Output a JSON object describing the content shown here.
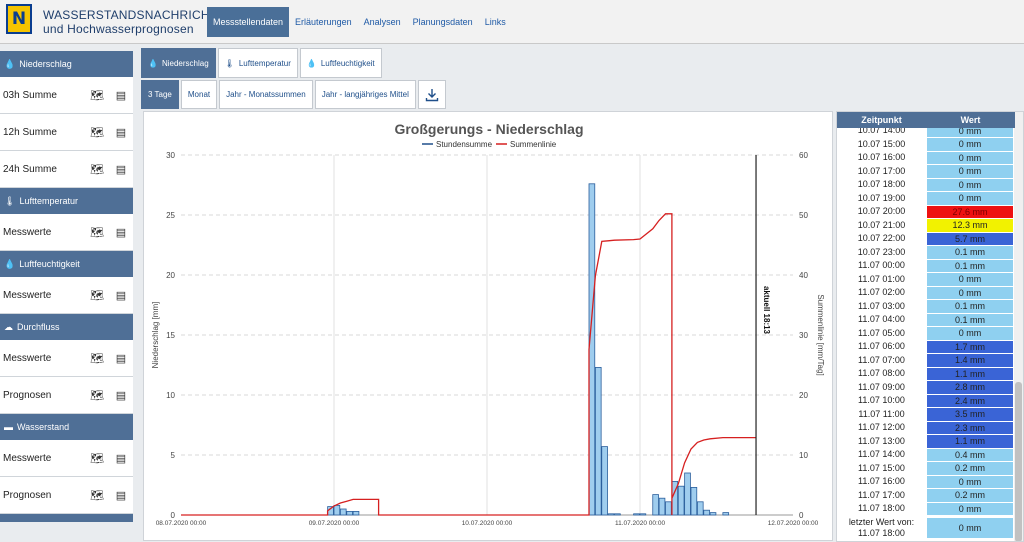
{
  "header": {
    "logo_letter": "N",
    "brand_line1": "WASSERSTANDSNACHRICHTEN",
    "brand_line2": "und Hochwasserprognosen",
    "nav": [
      "Messstellendaten",
      "Erläuterungen",
      "Analysen",
      "Planungsdaten",
      "Links"
    ]
  },
  "sidebar": {
    "sections": [
      {
        "title": "Niederschlag",
        "icon": "rain-drops-icon",
        "items": [
          "03h Summe",
          "12h Summe",
          "24h Summe"
        ]
      },
      {
        "title": "Lufttemperatur",
        "icon": "thermometer-icon",
        "items": [
          "Messwerte"
        ]
      },
      {
        "title": "Luftfeuchtigkeit",
        "icon": "drop-icon",
        "items": [
          "Messwerte"
        ]
      },
      {
        "title": "Durchfluss",
        "icon": "flow-icon",
        "items": [
          "Messwerte",
          "Prognosen"
        ]
      },
      {
        "title": "Wasserstand",
        "icon": "water-level-icon",
        "items": [
          "Messwerte",
          "Prognosen"
        ]
      }
    ]
  },
  "tabs": {
    "parameter": [
      "Niederschlag",
      "Lufttemperatur",
      "Luftfeuchtigkeit"
    ],
    "period": [
      "3 Tage",
      "Monat",
      "Jahr - Monatssummen",
      "Jahr - langjähriges Mittel"
    ]
  },
  "chart_data": {
    "type": "bar",
    "title": "Großgerungs - Niederschlag",
    "legend": [
      "Stundensumme",
      "Summenlinie"
    ],
    "ylabel": "Niederschlag [mm]",
    "y2label": "Summenlinie [mm/Tag]",
    "ylim": [
      0,
      30
    ],
    "y2lim": [
      0,
      60
    ],
    "yticks": [
      0,
      5,
      10,
      15,
      20,
      25,
      30
    ],
    "y2ticks": [
      0,
      10,
      20,
      30,
      40,
      50,
      60
    ],
    "xlim_hours": [
      0,
      96
    ],
    "xticks": [
      "08.07.2020 00:00",
      "09.07.2020 00:00",
      "10.07.2020 00:00",
      "11.07.2020 00:00",
      "12.07.2020 00:00"
    ],
    "now_hour": 90.2,
    "now_label": "aktuell 18:13",
    "bars": [
      {
        "h": 23,
        "v": 0.7
      },
      {
        "h": 24,
        "v": 0.8
      },
      {
        "h": 25,
        "v": 0.5
      },
      {
        "h": 26,
        "v": 0.3
      },
      {
        "h": 27,
        "v": 0.3
      },
      {
        "h": 64,
        "v": 27.6
      },
      {
        "h": 65,
        "v": 12.3
      },
      {
        "h": 66,
        "v": 5.7
      },
      {
        "h": 67,
        "v": 0.1
      },
      {
        "h": 68,
        "v": 0.1
      },
      {
        "h": 69,
        "v": 0.0
      },
      {
        "h": 70,
        "v": 0.0
      },
      {
        "h": 71,
        "v": 0.1
      },
      {
        "h": 72,
        "v": 0.1
      },
      {
        "h": 73,
        "v": 0.0
      },
      {
        "h": 74,
        "v": 1.7
      },
      {
        "h": 75,
        "v": 1.4
      },
      {
        "h": 76,
        "v": 1.1
      },
      {
        "h": 77,
        "v": 2.8
      },
      {
        "h": 78,
        "v": 2.4
      },
      {
        "h": 79,
        "v": 3.5
      },
      {
        "h": 80,
        "v": 2.3
      },
      {
        "h": 81,
        "v": 1.1
      },
      {
        "h": 82,
        "v": 0.4
      },
      {
        "h": 83,
        "v": 0.2
      },
      {
        "h": 84,
        "v": 0.0
      },
      {
        "h": 85,
        "v": 0.2
      },
      {
        "h": 86,
        "v": 0.0
      },
      {
        "h": 87,
        "v": 0.0
      }
    ],
    "cumulative": [
      [
        0,
        0
      ],
      [
        23,
        0
      ],
      [
        23,
        0.7
      ],
      [
        24,
        1.5
      ],
      [
        25,
        2.0
      ],
      [
        26,
        2.3
      ],
      [
        27,
        2.6
      ],
      [
        31,
        2.6
      ],
      [
        31,
        0
      ],
      [
        64,
        0
      ],
      [
        64,
        27.6
      ],
      [
        65,
        39.9
      ],
      [
        66,
        45.6
      ],
      [
        67,
        45.7
      ],
      [
        68,
        45.8
      ],
      [
        71,
        45.9
      ],
      [
        72,
        46.0
      ],
      [
        74,
        47.7
      ],
      [
        75,
        49.1
      ],
      [
        76,
        50.2
      ],
      [
        77,
        50.2
      ],
      [
        77,
        0
      ],
      [
        77,
        2.8
      ],
      [
        78,
        5.2
      ],
      [
        79,
        8.7
      ],
      [
        80,
        11.0
      ],
      [
        81,
        12.1
      ],
      [
        82,
        12.5
      ],
      [
        83,
        12.7
      ],
      [
        85,
        12.9
      ],
      [
        87,
        12.9
      ],
      [
        90.2,
        12.9
      ]
    ]
  },
  "table": {
    "headers": [
      "Zeitpunkt",
      "Wert"
    ],
    "rows": [
      {
        "t": "10.07 14:00",
        "v": "0 mm",
        "c": "#8fd0f0"
      },
      {
        "t": "10.07 15:00",
        "v": "0 mm",
        "c": "#8fd0f0"
      },
      {
        "t": "10.07 16:00",
        "v": "0 mm",
        "c": "#8fd0f0"
      },
      {
        "t": "10.07 17:00",
        "v": "0 mm",
        "c": "#8fd0f0"
      },
      {
        "t": "10.07 18:00",
        "v": "0 mm",
        "c": "#8fd0f0"
      },
      {
        "t": "10.07 19:00",
        "v": "0 mm",
        "c": "#8fd0f0"
      },
      {
        "t": "10.07 20:00",
        "v": "27.6 mm",
        "c": "#ee1111"
      },
      {
        "t": "10.07 21:00",
        "v": "12.3 mm",
        "c": "#f2f200"
      },
      {
        "t": "10.07 22:00",
        "v": "5.7 mm",
        "c": "#3a64d6"
      },
      {
        "t": "10.07 23:00",
        "v": "0.1 mm",
        "c": "#8fd0f0"
      },
      {
        "t": "11.07 00:00",
        "v": "0.1 mm",
        "c": "#8fd0f0"
      },
      {
        "t": "11.07 01:00",
        "v": "0 mm",
        "c": "#8fd0f0"
      },
      {
        "t": "11.07 02:00",
        "v": "0 mm",
        "c": "#8fd0f0"
      },
      {
        "t": "11.07 03:00",
        "v": "0.1 mm",
        "c": "#8fd0f0"
      },
      {
        "t": "11.07 04:00",
        "v": "0.1 mm",
        "c": "#8fd0f0"
      },
      {
        "t": "11.07 05:00",
        "v": "0 mm",
        "c": "#8fd0f0"
      },
      {
        "t": "11.07 06:00",
        "v": "1.7 mm",
        "c": "#3a64d6"
      },
      {
        "t": "11.07 07:00",
        "v": "1.4 mm",
        "c": "#3a64d6"
      },
      {
        "t": "11.07 08:00",
        "v": "1.1 mm",
        "c": "#3a64d6"
      },
      {
        "t": "11.07 09:00",
        "v": "2.8 mm",
        "c": "#3a64d6"
      },
      {
        "t": "11.07 10:00",
        "v": "2.4 mm",
        "c": "#3a64d6"
      },
      {
        "t": "11.07 11:00",
        "v": "3.5 mm",
        "c": "#3a64d6"
      },
      {
        "t": "11.07 12:00",
        "v": "2.3 mm",
        "c": "#3a64d6"
      },
      {
        "t": "11.07 13:00",
        "v": "1.1 mm",
        "c": "#3a64d6"
      },
      {
        "t": "11.07 14:00",
        "v": "0.4 mm",
        "c": "#8fd0f0"
      },
      {
        "t": "11.07 15:00",
        "v": "0.2 mm",
        "c": "#8fd0f0"
      },
      {
        "t": "11.07 16:00",
        "v": "0 mm",
        "c": "#8fd0f0"
      },
      {
        "t": "11.07 17:00",
        "v": "0.2 mm",
        "c": "#8fd0f0"
      },
      {
        "t": "11.07 18:00",
        "v": "0 mm",
        "c": "#8fd0f0"
      }
    ],
    "last_label_1": "letzter Wert von:",
    "last_label_2": "11.07 18:00",
    "last_value": "0 mm",
    "last_color": "#8fd0f0"
  }
}
